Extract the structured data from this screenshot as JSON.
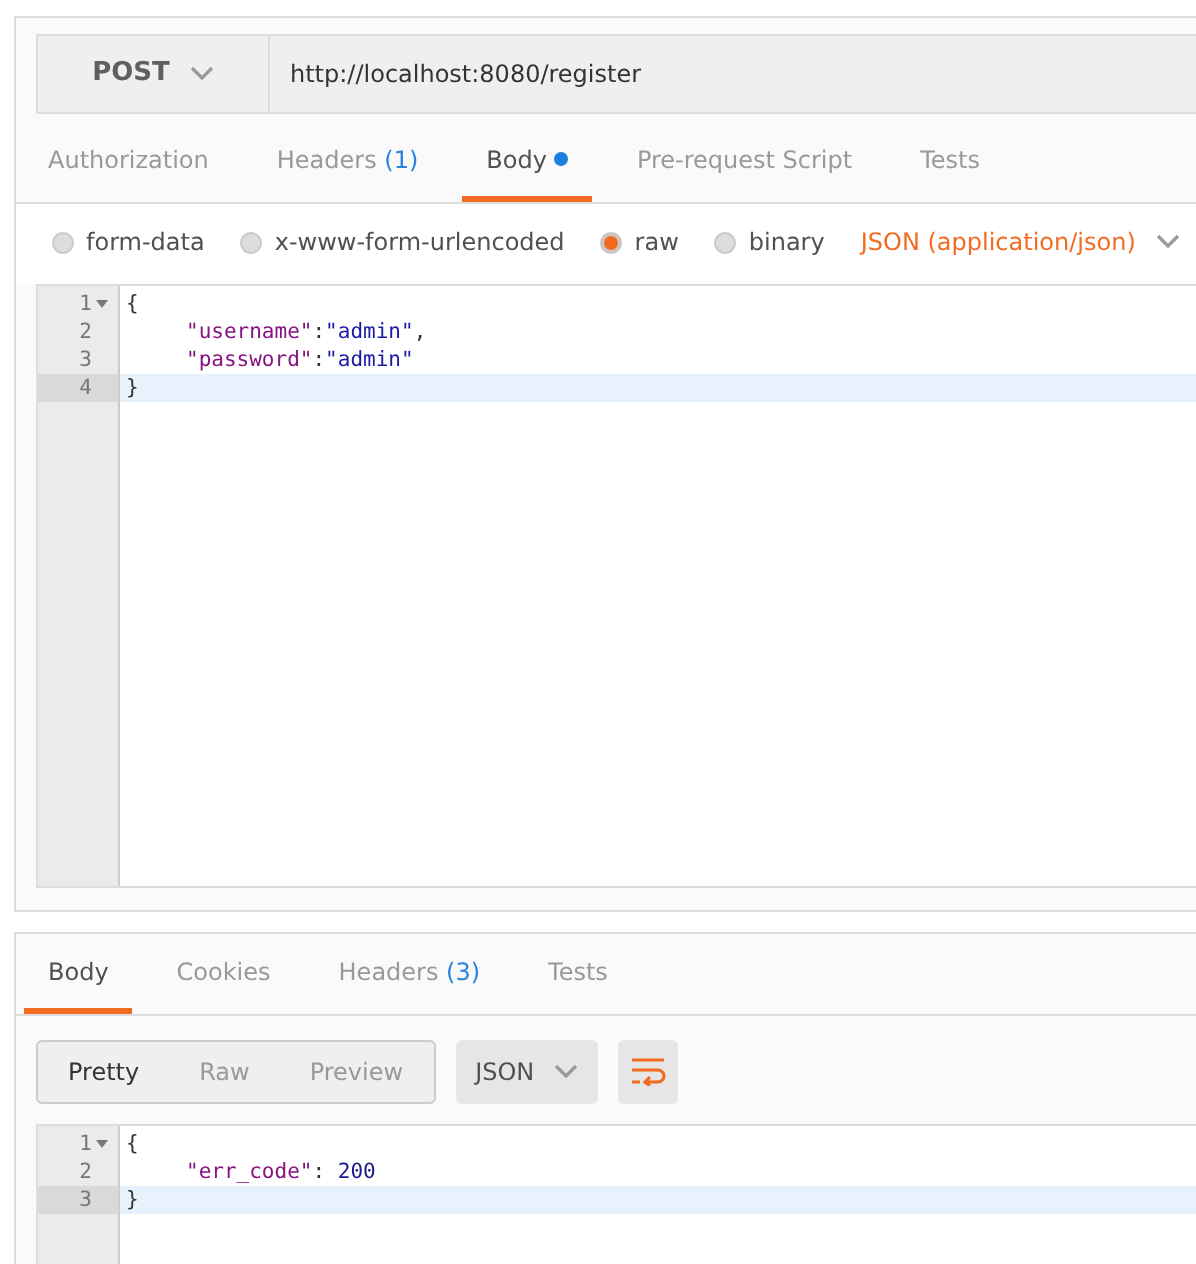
{
  "request": {
    "method": "POST",
    "url": "http://localhost:8080/register",
    "tabs": [
      {
        "label": "Authorization",
        "selected": false
      },
      {
        "label": "Headers",
        "count": "(1)",
        "selected": false
      },
      {
        "label": "Body",
        "dot": true,
        "selected": true
      },
      {
        "label": "Pre-request Script",
        "selected": false
      },
      {
        "label": "Tests",
        "selected": false
      }
    ],
    "body_modes": [
      {
        "label": "form-data",
        "selected": false
      },
      {
        "label": "x-www-form-urlencoded",
        "selected": false
      },
      {
        "label": "raw",
        "selected": true
      },
      {
        "label": "binary",
        "selected": false
      }
    ],
    "content_type": "JSON (application/json)",
    "editor": {
      "lines": [
        {
          "number": "1",
          "fold": true,
          "active": false,
          "indented": false,
          "tokens": [
            {
              "kind": "punct",
              "text": "{"
            }
          ]
        },
        {
          "number": "2",
          "fold": false,
          "active": false,
          "indented": true,
          "tokens": [
            {
              "kind": "key",
              "text": "\"username\""
            },
            {
              "kind": "punct",
              "text": ":"
            },
            {
              "kind": "string",
              "text": "\"admin\""
            },
            {
              "kind": "punct",
              "text": ","
            }
          ]
        },
        {
          "number": "3",
          "fold": false,
          "active": false,
          "indented": true,
          "tokens": [
            {
              "kind": "key",
              "text": "\"password\""
            },
            {
              "kind": "punct",
              "text": ":"
            },
            {
              "kind": "string",
              "text": "\"admin\""
            }
          ]
        },
        {
          "number": "4",
          "fold": false,
          "active": true,
          "indented": false,
          "tokens": [
            {
              "kind": "punct",
              "text": "}"
            }
          ]
        }
      ]
    }
  },
  "response": {
    "tabs": [
      {
        "label": "Body",
        "selected": true
      },
      {
        "label": "Cookies",
        "selected": false
      },
      {
        "label": "Headers",
        "count": "(3)",
        "selected": false
      },
      {
        "label": "Tests",
        "selected": false
      }
    ],
    "views": [
      {
        "label": "Pretty",
        "selected": true
      },
      {
        "label": "Raw",
        "selected": false
      },
      {
        "label": "Preview",
        "selected": false
      }
    ],
    "format": "JSON",
    "editor": {
      "lines": [
        {
          "number": "1",
          "fold": true,
          "active": false,
          "indented": false,
          "tokens": [
            {
              "kind": "punct",
              "text": "{"
            }
          ]
        },
        {
          "number": "2",
          "fold": false,
          "active": false,
          "indented": true,
          "tokens": [
            {
              "kind": "key",
              "text": "\"err_code\""
            },
            {
              "kind": "punct",
              "text": ": "
            },
            {
              "kind": "number",
              "text": "200"
            }
          ]
        },
        {
          "number": "3",
          "fold": false,
          "active": true,
          "indented": false,
          "tokens": [
            {
              "kind": "punct",
              "text": "}"
            }
          ]
        }
      ]
    }
  }
}
